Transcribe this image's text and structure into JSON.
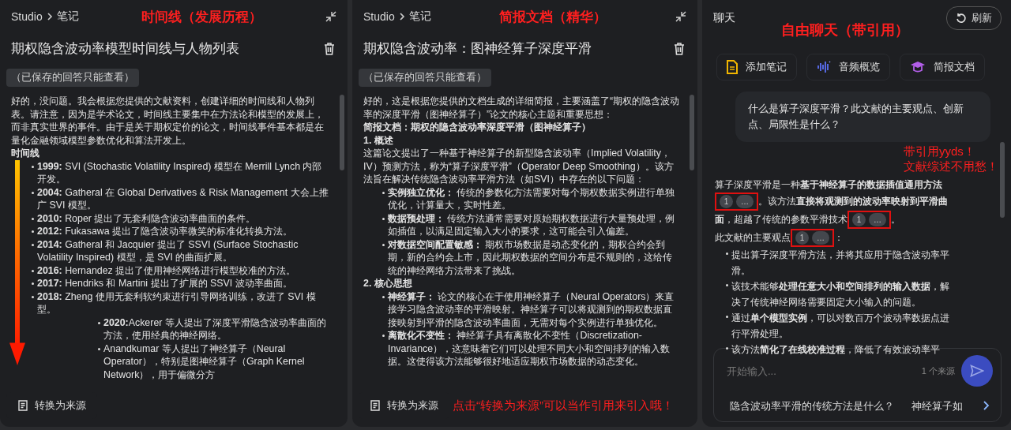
{
  "panels": [
    {
      "kind": "note",
      "breadcrumb": [
        "Studio",
        "笔记"
      ],
      "annotation": "时间线（发展历程）",
      "title": "期权隐含波动率模型时间线与人物列表",
      "badge": "（已保存的回答只能查看）",
      "blocks": [
        {
          "kind": "para",
          "text": "好的，没问题。我会根据您提供的文献资料，创建详细的时间线和人物列表。请注意，因为是学术论文，时间线主要集中在方法论和模型的发展上，而非真实世界的事件。由于是关于期权定价的论文，时间线事件基本都是在量化金融领域模型参数优化和算法开发上。"
        },
        {
          "kind": "heading",
          "text": "时间线"
        },
        {
          "kind": "list",
          "arrow": true,
          "items": [
            {
              "text": "**1999:** SVI (Stochastic Volatility Inspired) 模型在 Merrill Lynch 内部开发。"
            },
            {
              "text": "**2004:** Gatheral 在 Global Derivatives & Risk Management 大会上推广 SVI 模型。"
            },
            {
              "text": "**2010:** Roper 提出了无套利隐含波动率曲面的条件。"
            },
            {
              "text": "**2012:** Fukasawa 提出了隐含波动率微笑的标准化转换方法。"
            },
            {
              "text": "**2014:** Gatheral 和 Jacquier 提出了 SSVI (Surface Stochastic Volatility Inspired) 模型，是 SVI 的曲面扩展。"
            },
            {
              "text": "**2016:** Hernandez 提出了使用神经网络进行模型校准的方法。"
            },
            {
              "text": "**2017:** Hendriks 和 Martini 提出了扩展的 SSVI 波动率曲面。"
            },
            {
              "text": "**2018:** Zheng 使用无套利软约束进行引导网络训练，改进了 SVI 模型。",
              "children": [
                {
                  "text": "**2020:**Ackerer 等人提出了深度平滑隐含波动率曲面的方法，使用经典的神经网络。"
                },
                {
                  "text": "Anandkumar 等人提出了神经算子（Neural Operator），特别是图神经算子（Graph Kernel Network），用于偏微分方"
                }
              ]
            }
          ]
        }
      ],
      "footer_button": "转换为来源"
    },
    {
      "kind": "note",
      "breadcrumb": [
        "Studio",
        "笔记"
      ],
      "annotation": "简报文档（精华）",
      "title": "期权隐含波动率：图神经算子深度平滑",
      "badge": "（已保存的回答只能查看）",
      "blocks": [
        {
          "kind": "para",
          "text": "好的，这是根据您提供的文档生成的详细简报，主要涵盖了“期权的隐含波动率的深度平滑（图神经算子）”论文的核心主题和重要思想："
        },
        {
          "kind": "heading",
          "text": "简报文档：期权的隐含波动率深度平滑（图神经算子）"
        },
        {
          "kind": "heading",
          "text": "1. 概述"
        },
        {
          "kind": "para",
          "text": "这篇论文提出了一种基于神经算子的新型隐含波动率（Implied Volatility，IV）预测方法，称为“算子深度平滑”（Operator Deep Smoothing）。该方法旨在解决传统隐含波动率平滑方法（如SVI）中存在的以下问题："
        },
        {
          "kind": "list",
          "items": [
            {
              "text": "**实例独立优化：** 传统的参数化方法需要对每个期权数据实例进行单独优化，计算量大，实时性差。"
            },
            {
              "text": "**数据预处理：** 传统方法通常需要对原始期权数据进行大量预处理，例如插值，以满足固定输入大小的要求，这可能会引入偏差。"
            },
            {
              "text": "**对数据空间配置敏感：** 期权市场数据是动态变化的，期权合约会到期，新的合约会上市，因此期权数据的空间分布是不规则的，这给传统的神经网络方法带来了挑战。"
            }
          ]
        },
        {
          "kind": "heading",
          "text": "2. 核心思想"
        },
        {
          "kind": "list",
          "items": [
            {
              "text": "**神经算子：** 论文的核心在于使用神经算子（Neural Operators）来直接学习隐含波动率的平滑映射。神经算子可以将观测到的期权数据直接映射到平滑的隐含波动率曲面，无需对每个实例进行单独优化。"
            },
            {
              "text": "**离散化不变性：** 神经算子具有离散化不变性（Discretization-Invariance），这意味着它们可以处理不同大小和空间排列的输入数据。这使得该方法能够很好地适应期权市场数据的动态变化。"
            }
          ]
        }
      ],
      "footer_button": "转换为来源",
      "footer_note": "点击“转换为来源”可以当作引用来引入哦！"
    },
    {
      "kind": "chat",
      "title": "聊天",
      "refresh_label": "刷新",
      "annotation": "自由聊天（带引用）",
      "actions": [
        {
          "kind": "note",
          "label": "添加笔记"
        },
        {
          "kind": "audio",
          "label": "音频概览"
        },
        {
          "kind": "cap",
          "label": "简报文档"
        }
      ],
      "user_message": "什么是算子深度平滑？此文献的主要观点、创新点、局限性是什么？",
      "answer": [
        [
          {
            "kind": "text",
            "text": "算子深度平滑是一种**基于神经算子的数据插值通用方法**"
          },
          {
            "kind": "cite",
            "number": "1",
            "more": "…"
          },
          {
            "kind": "text",
            "text": "。该方法**直接将观测到的波动率映射到平滑曲面**，超越了传统的参数平滑技术"
          },
          {
            "kind": "cite",
            "number": "1",
            "more": "…"
          },
          {
            "kind": "text",
            "text": "。"
          }
        ],
        [
          {
            "kind": "text",
            "text": "此文献的主要观点"
          },
          {
            "kind": "cite",
            "number": "1",
            "more": "…"
          },
          {
            "kind": "text",
            "text": "："
          }
        ]
      ],
      "bullets": [
        "提出算子深度平滑方法，并将其应用于隐含波动率平滑。",
        "该技术能够**处理任意大小和空间排列的输入数据**，解决了传统神经网络需要固定大小输入的问题。",
        "通过**单个模型实例**，可以对数百万个波动率数据点进行平滑处理。",
        "该方法**简化了在线校准过程**，降低了有效波动率平"
      ],
      "side_note": [
        "带引用yyds！",
        "文献综述不用愁！"
      ],
      "input": {
        "placeholder": "开始输入...",
        "source_count": "1 个来源"
      },
      "suggestions": [
        "隐含波动率平滑的传统方法是什么？",
        "神经算子如"
      ]
    }
  ]
}
